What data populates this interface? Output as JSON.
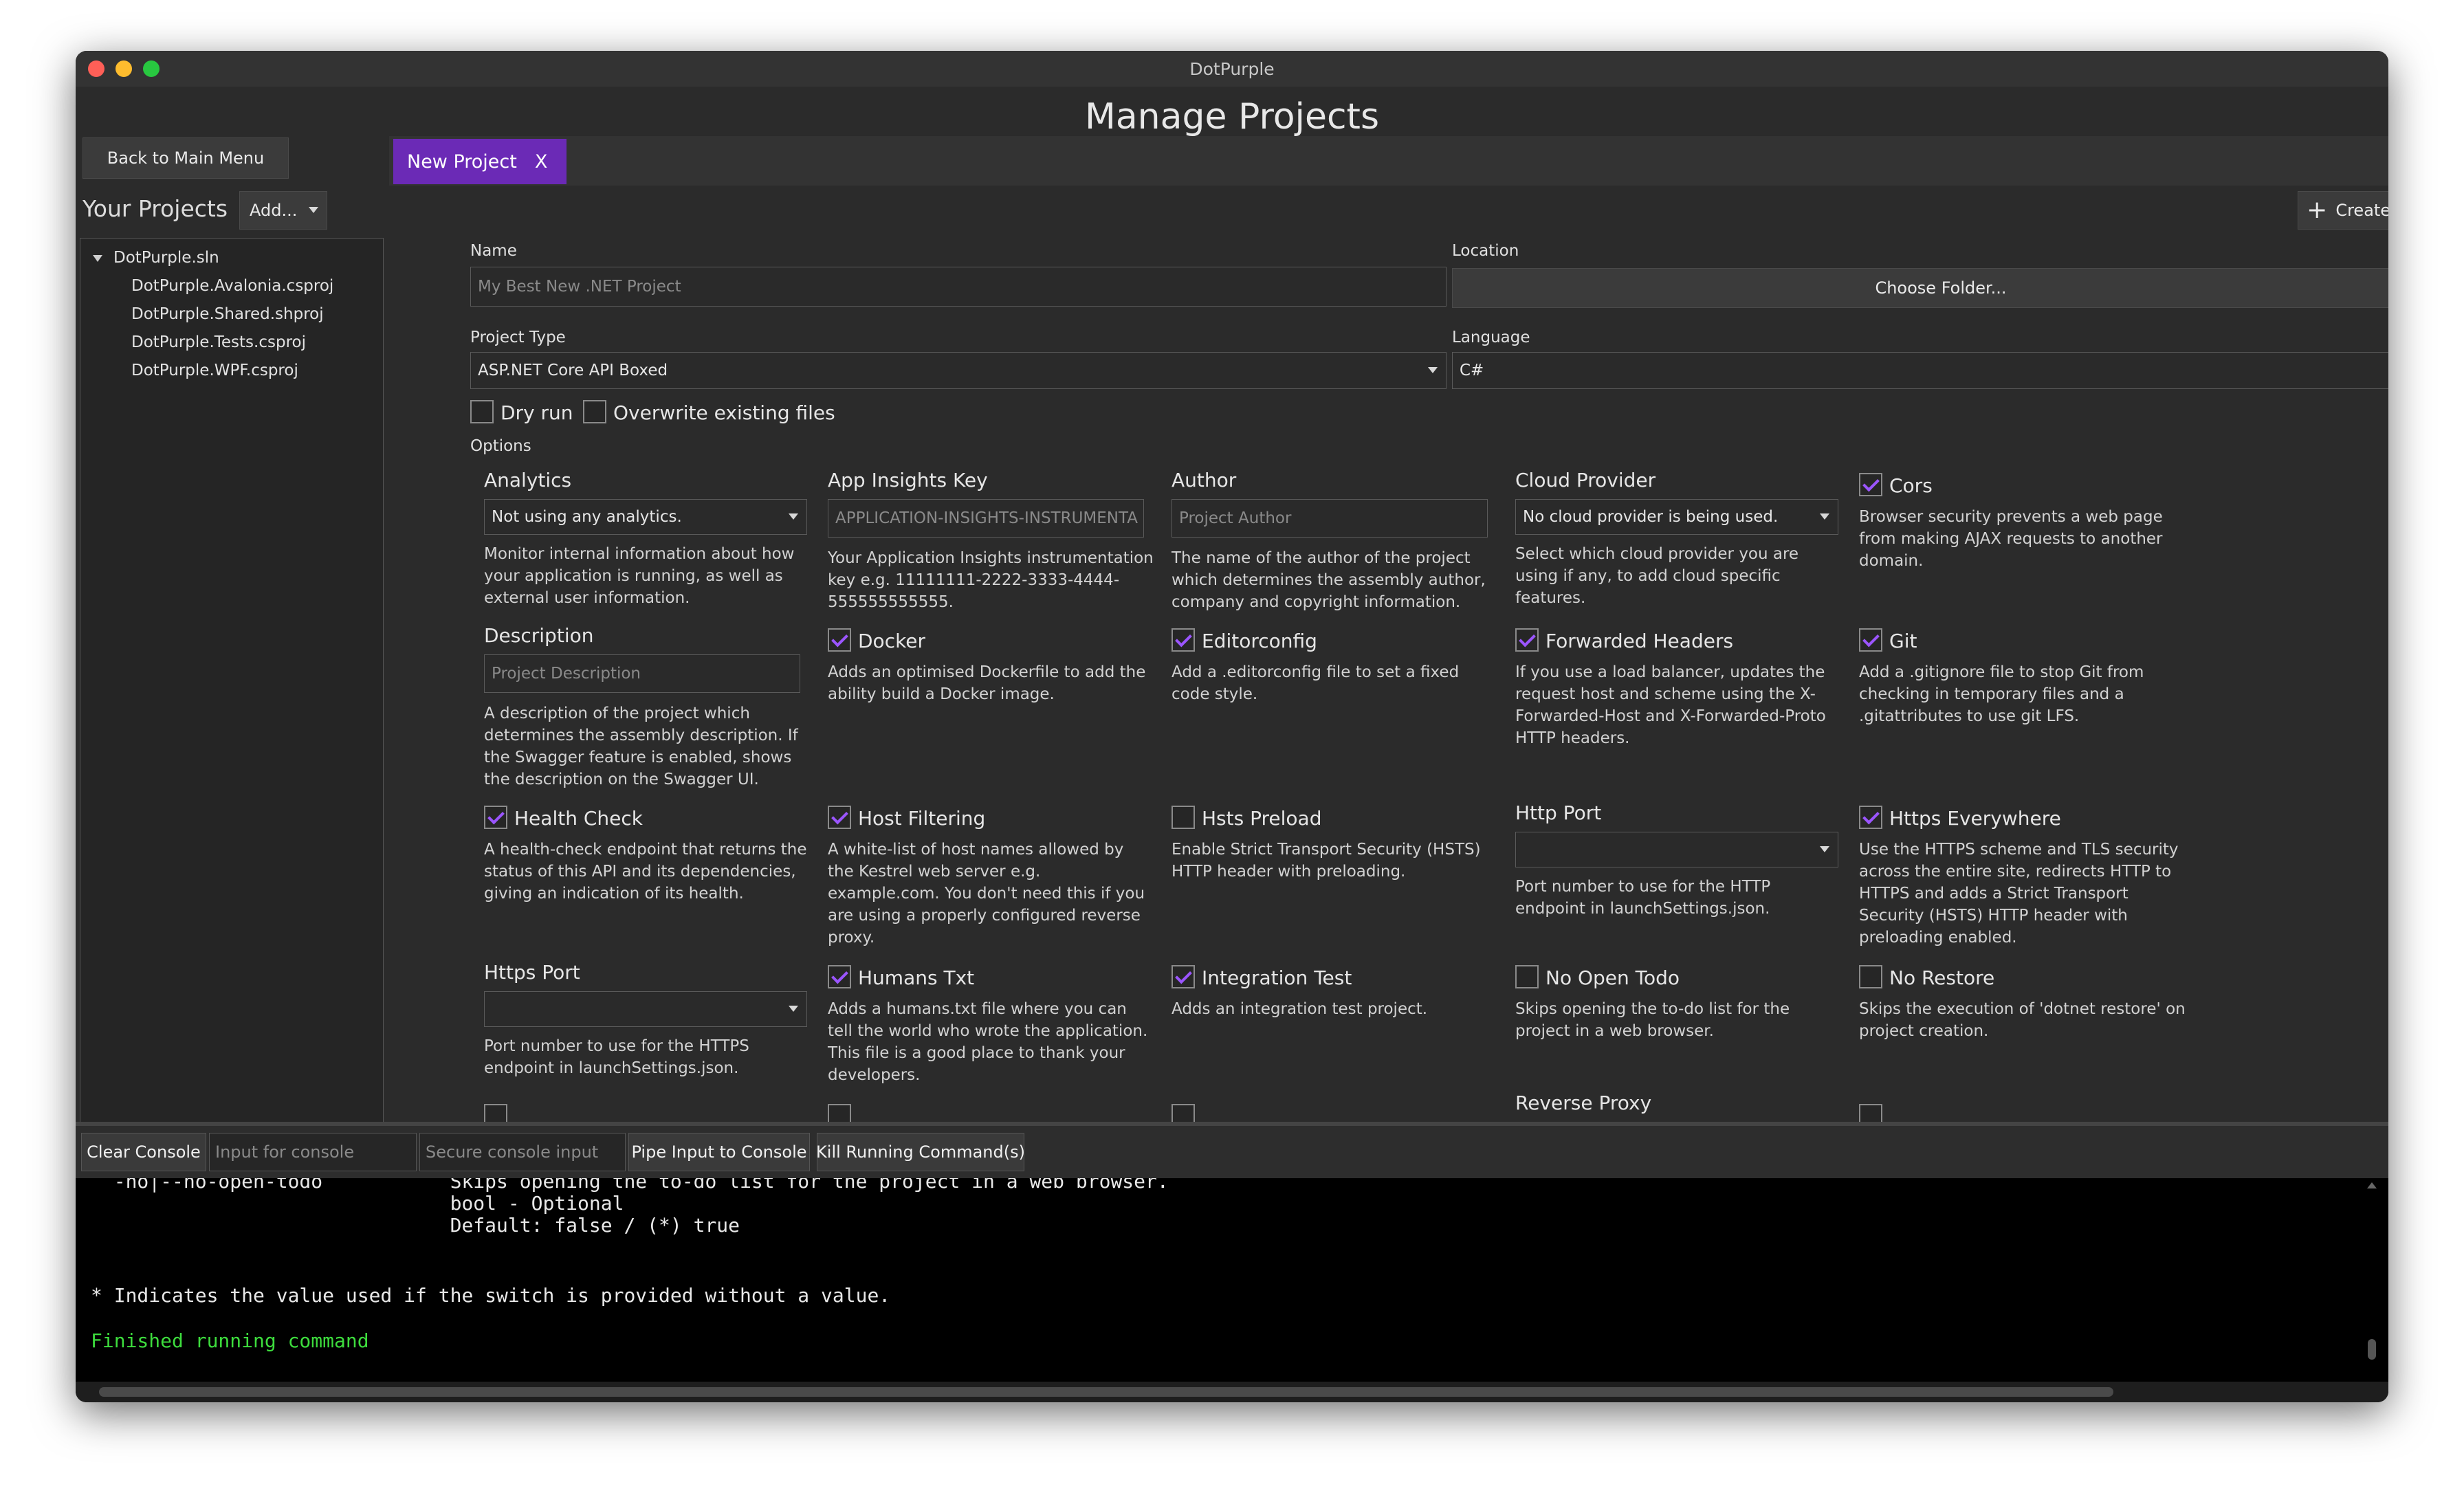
{
  "window": {
    "title": "DotPurple"
  },
  "header": {
    "back_label": "Back to Main Menu",
    "title": "Manage Projects"
  },
  "sidebar": {
    "title": "Your Projects",
    "add_label": "Add...",
    "tree": [
      {
        "label": "DotPurple.sln",
        "level": 0
      },
      {
        "label": "DotPurple.Avalonia.csproj",
        "level": 1
      },
      {
        "label": "DotPurple.Shared.shproj",
        "level": 1
      },
      {
        "label": "DotPurple.Tests.csproj",
        "level": 1
      },
      {
        "label": "DotPurple.WPF.csproj",
        "level": 1
      }
    ]
  },
  "tab": {
    "label": "New Project",
    "close": "X"
  },
  "form": {
    "create_label": "Create Project",
    "name_label": "Name",
    "name_placeholder": "My Best New .NET Project",
    "location_label": "Location",
    "choose_folder": "Choose Folder...",
    "project_type_label": "Project Type",
    "project_type_value": "ASP.NET Core API Boxed",
    "language_label": "Language",
    "language_value": "C#",
    "dry_run": "Dry run",
    "overwrite": "Overwrite existing files",
    "options_label": "Options"
  },
  "options": {
    "analytics": {
      "title": "Analytics",
      "value": "Not using any analytics.",
      "desc": "Monitor internal information about how your application is running, as well as external user information."
    },
    "appinsights": {
      "title": "App Insights Key",
      "placeholder": "APPLICATION-INSIGHTS-INSTRUMENTA",
      "desc": "Your Application Insights instrumentation key e.g. 11111111-2222-3333-4444-555555555555."
    },
    "author": {
      "title": "Author",
      "placeholder": "Project Author",
      "desc": "The name of the author of the project which determines the assembly author, company and copyright information."
    },
    "cloud": {
      "title": "Cloud Provider",
      "value": "No cloud provider is being used.",
      "desc": "Select which cloud provider you are using if any, to add cloud specific features."
    },
    "cors": {
      "title": "Cors",
      "desc": "Browser security prevents a web page from making AJAX requests to another domain."
    },
    "description": {
      "title": "Description",
      "placeholder": "Project Description",
      "desc": "A description of the project which determines the assembly description. If the Swagger feature is enabled, shows the description on the Swagger UI."
    },
    "docker": {
      "title": "Docker",
      "desc": "Adds an optimised Dockerfile to add the ability build a Docker image."
    },
    "editorconfig": {
      "title": "Editorconfig",
      "desc": "Add a .editorconfig file to set a fixed code style."
    },
    "forwarded": {
      "title": "Forwarded Headers",
      "desc": "If you use a load balancer, updates the request host and scheme using the X-Forwarded-Host and X-Forwarded-Proto HTTP headers."
    },
    "git": {
      "title": "Git",
      "desc": "Add a .gitignore file to stop Git from checking in temporary files and a .gitattributes to use git LFS."
    },
    "health": {
      "title": "Health Check",
      "desc": "A health-check endpoint that returns the status of this API and its dependencies, giving an indication of its health."
    },
    "hostfilter": {
      "title": "Host Filtering",
      "desc": "A white-list of host names allowed by the Kestrel web server e.g. example.com. You don't need this if you are using a properly configured reverse proxy."
    },
    "hsts": {
      "title": "Hsts Preload",
      "desc": "Enable Strict Transport Security (HSTS) HTTP header with preloading."
    },
    "httpport": {
      "title": "Http Port",
      "desc": "Port number to use for the HTTP endpoint in launchSettings.json."
    },
    "httpseverywhere": {
      "title": "Https Everywhere",
      "desc": "Use the HTTPS scheme and TLS security across the entire site, redirects HTTP to HTTPS and adds a Strict Transport Security (HSTS) HTTP header with preloading enabled."
    },
    "httpsport": {
      "title": "Https Port",
      "desc": "Port number to use for the HTTPS endpoint in launchSettings.json."
    },
    "humans": {
      "title": "Humans Txt",
      "desc": "Adds a humans.txt file where you can tell the world who wrote the application. This file is a good place to thank your developers."
    },
    "integration": {
      "title": "Integration Test",
      "desc": "Adds an integration test project."
    },
    "noopentodo": {
      "title": "No Open Todo",
      "desc": "Skips opening the to-do list for the project in a web browser."
    },
    "norestore": {
      "title": "No Restore",
      "desc": "Skips the execution of 'dotnet restore' on project creation."
    },
    "reverseproxy": {
      "title": "Reverse Proxy"
    }
  },
  "console_bar": {
    "clear": "Clear Console",
    "input_placeholder": "Input for console",
    "secure_placeholder": "Secure console input",
    "pipe": "Pipe Input to Console",
    "kill": "Kill Running Command(s)"
  },
  "console": {
    "lines": [
      "  -no|--no-open-todo           Skips opening the to-do list for the project in a web browser.",
      "                               bool - Optional",
      "                               Default: false / (*) true",
      "* Indicates the value used if the switch is provided without a value.",
      "Finished running command"
    ],
    "success_color": "#3ddc3d"
  },
  "colors": {
    "accent": "#6b2ab6",
    "check": "#9b55ff"
  }
}
